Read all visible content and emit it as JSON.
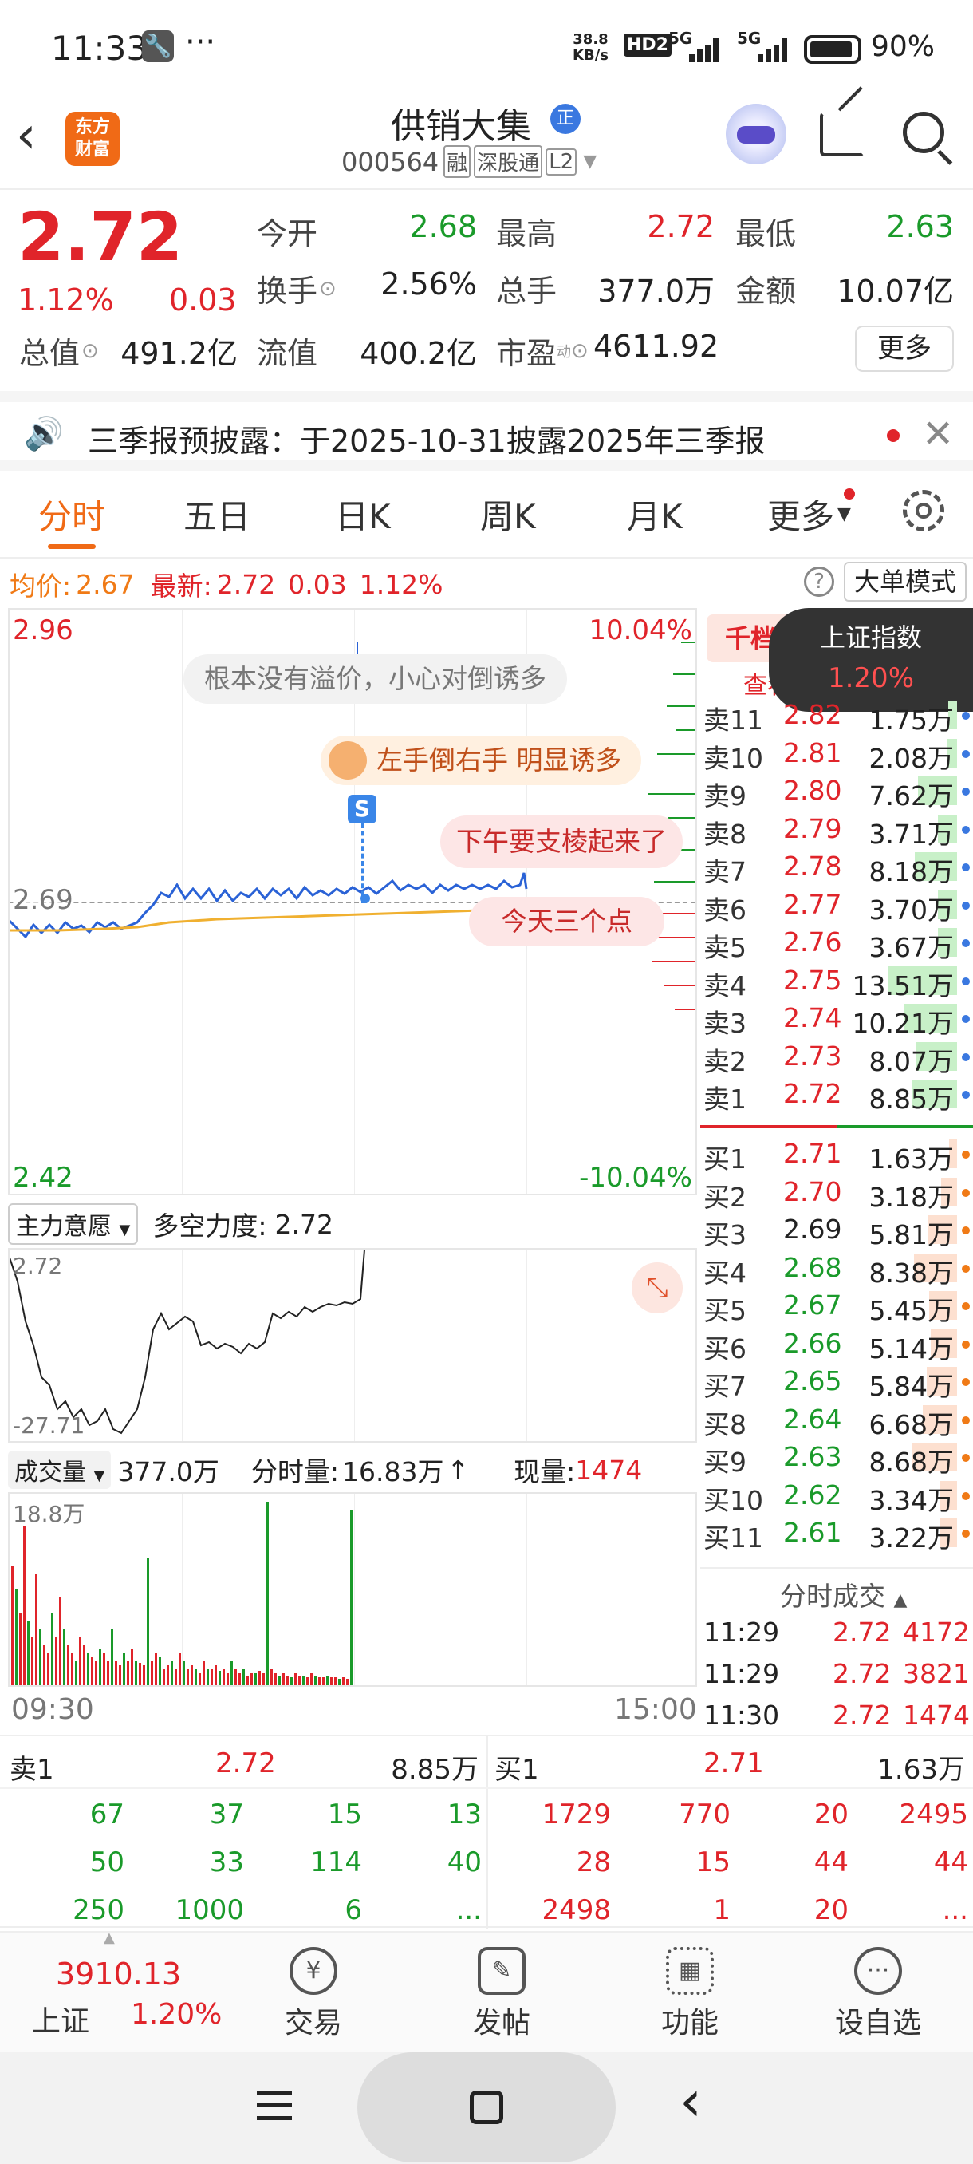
{
  "status_bar": {
    "time": "11:33",
    "net_speed_top": "38.8",
    "net_speed_bottom": "KB/s",
    "signal1": "5G",
    "signal2": "5G",
    "battery": "90%",
    "hd": "HD2"
  },
  "header": {
    "logo_line1": "东方",
    "logo_line2": "财富",
    "title": "供销大集",
    "badge": "正",
    "code": "000564",
    "tag1": "融",
    "tag2": "深股通",
    "tag3": "L2"
  },
  "quote": {
    "price": "2.72",
    "change_pct": "1.12%",
    "change": "0.03",
    "fields": [
      {
        "label": "今开",
        "value": "2.68",
        "color": "green"
      },
      {
        "label": "最高",
        "value": "2.72",
        "color": "red"
      },
      {
        "label": "最低",
        "value": "2.63",
        "color": "green"
      },
      {
        "label": "换手",
        "value": "2.56%",
        "color": "black"
      },
      {
        "label": "总手",
        "value": "377.0万",
        "color": "black"
      },
      {
        "label": "金额",
        "value": "10.07亿",
        "color": "black"
      },
      {
        "label": "总值",
        "value": "491.2亿",
        "color": "black"
      },
      {
        "label": "流值",
        "value": "400.2亿",
        "color": "black"
      },
      {
        "label": "市盈",
        "value": "4611.92",
        "color": "black"
      }
    ],
    "pe_sup": "动",
    "more_button": "更多"
  },
  "notice": {
    "text": "三季报预披露：于2025-10-31披露2025年三季报"
  },
  "tabs": [
    "分时",
    "五日",
    "日K",
    "周K",
    "月K",
    "更多"
  ],
  "chart_header": {
    "avg_label": "均价:",
    "avg_value": "2.67",
    "latest_label": "最新:",
    "latest_value": "2.72",
    "change": "0.03",
    "pct": "1.12%",
    "mode_button": "大单模式",
    "help": "?"
  },
  "chart_axis": {
    "top_left": "2.96",
    "top_right": "10.04%",
    "mid_left": "2.69",
    "bottom_left": "2.42",
    "bottom_right": "-10.04%"
  },
  "comments": [
    {
      "text": "根本没有溢价，小心对倒诱多"
    },
    {
      "text": "左手倒右手 明显诱多"
    },
    {
      "text": "下午要支棱起来了"
    },
    {
      "text": "今天三个点"
    }
  ],
  "marker_s": "S",
  "indicator": {
    "selector": "主力意愿",
    "label": "多空力度:",
    "value": "2.72",
    "max": "2.72",
    "min": "-27.71"
  },
  "volume": {
    "selector": "成交量",
    "total": "377.0万",
    "minute_label": "分时量:",
    "minute_value": "16.83万",
    "current_label": "现量:",
    "current_value": "1474",
    "max": "18.8万",
    "start_time": "09:30",
    "end_time": "15:00"
  },
  "order_book_header": {
    "tab": "千档",
    "sub": "查看",
    "index_name": "上证指数",
    "index_pct": "1.20%"
  },
  "asks": [
    {
      "label": "卖11",
      "price": "2.82",
      "vol": "1.75万"
    },
    {
      "label": "卖10",
      "price": "2.81",
      "vol": "2.08万"
    },
    {
      "label": "卖9",
      "price": "2.80",
      "vol": "7.62万"
    },
    {
      "label": "卖8",
      "price": "2.79",
      "vol": "3.71万"
    },
    {
      "label": "卖7",
      "price": "2.78",
      "vol": "8.18万"
    },
    {
      "label": "卖6",
      "price": "2.77",
      "vol": "3.70万"
    },
    {
      "label": "卖5",
      "price": "2.76",
      "vol": "3.67万"
    },
    {
      "label": "卖4",
      "price": "2.75",
      "vol": "13.51万"
    },
    {
      "label": "卖3",
      "price": "2.74",
      "vol": "10.21万"
    },
    {
      "label": "卖2",
      "price": "2.73",
      "vol": "8.07万"
    },
    {
      "label": "卖1",
      "price": "2.72",
      "vol": "8.85万"
    }
  ],
  "bids": [
    {
      "label": "买1",
      "price": "2.71",
      "vol": "1.63万"
    },
    {
      "label": "买2",
      "price": "2.70",
      "vol": "3.18万"
    },
    {
      "label": "买3",
      "price": "2.69",
      "vol": "5.81万"
    },
    {
      "label": "买4",
      "price": "2.68",
      "vol": "8.38万"
    },
    {
      "label": "买5",
      "price": "2.67",
      "vol": "5.45万"
    },
    {
      "label": "买6",
      "price": "2.66",
      "vol": "5.14万"
    },
    {
      "label": "买7",
      "price": "2.65",
      "vol": "5.84万"
    },
    {
      "label": "买8",
      "price": "2.64",
      "vol": "6.68万"
    },
    {
      "label": "买9",
      "price": "2.63",
      "vol": "8.68万"
    },
    {
      "label": "买10",
      "price": "2.62",
      "vol": "3.34万"
    },
    {
      "label": "买11",
      "price": "2.61",
      "vol": "3.22万"
    }
  ],
  "ticks_header": "分时成交",
  "ticks": [
    {
      "time": "11:29",
      "price": "2.72",
      "vol": "4172"
    },
    {
      "time": "11:29",
      "price": "2.72",
      "vol": "3821"
    },
    {
      "time": "11:30",
      "price": "2.72",
      "vol": "1474"
    }
  ],
  "queue": {
    "sell_label": "卖1",
    "sell_price": "2.72",
    "sell_vol": "8.85万",
    "buy_label": "买1",
    "buy_price": "2.71",
    "buy_vol": "1.63万",
    "sell_rows": [
      [
        "67",
        "37",
        "15",
        "13"
      ],
      [
        "50",
        "33",
        "114",
        "40"
      ],
      [
        "250",
        "1000",
        "6",
        "..."
      ]
    ],
    "buy_rows": [
      [
        "1729",
        "770",
        "20",
        "2495"
      ],
      [
        "28",
        "15",
        "44",
        "44"
      ],
      [
        "2498",
        "1",
        "20",
        "..."
      ]
    ]
  },
  "bottom_nav": {
    "index_value": "3910.13",
    "index_name": "上证",
    "index_pct": "1.20%",
    "items": [
      "交易",
      "发帖",
      "功能",
      "设自选"
    ]
  },
  "chart_data": {
    "type": "line",
    "series": [],
    "ylim": [
      2.42,
      2.96
    ]
  }
}
